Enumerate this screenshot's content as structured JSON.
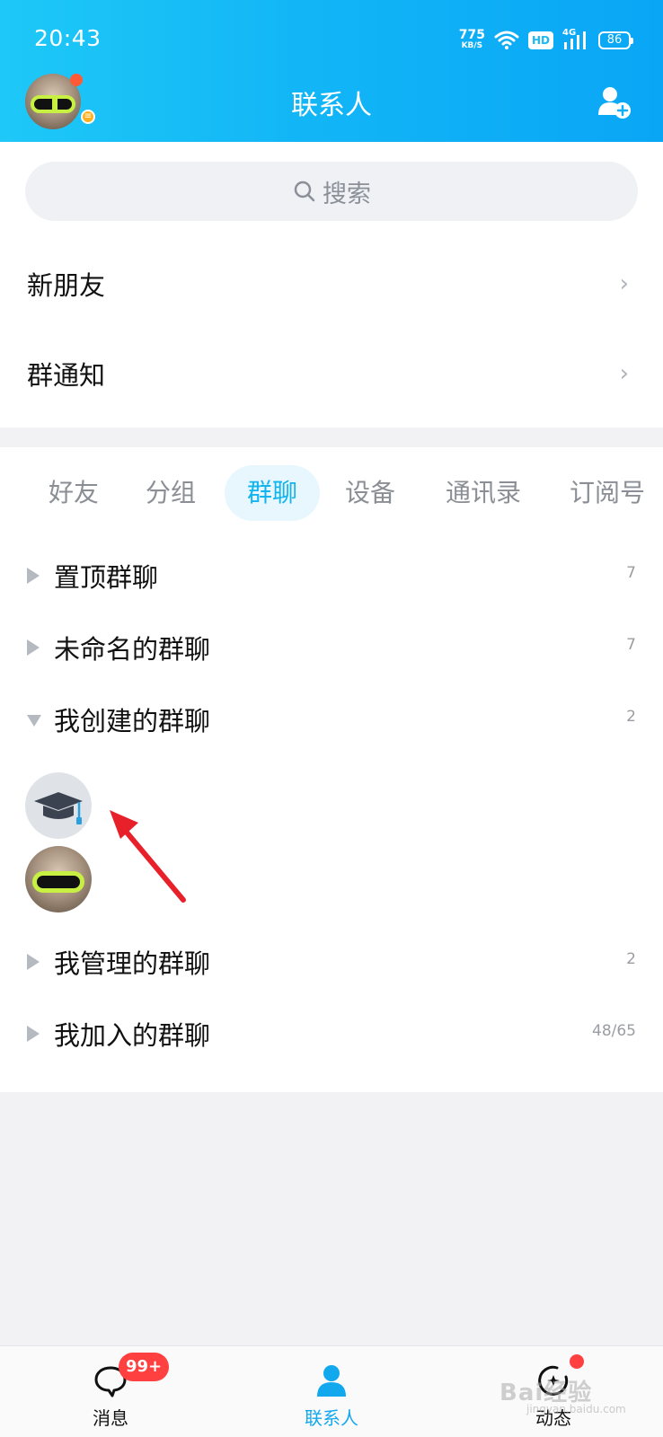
{
  "status_bar": {
    "time": "20:43",
    "net_speed_value": "775",
    "net_speed_unit": "KB/S",
    "hd": "HD",
    "network": "4G",
    "battery": "86"
  },
  "header": {
    "title": "联系人",
    "avatar_status_icon": "menu-icon"
  },
  "search": {
    "placeholder": "搜索"
  },
  "entries": [
    {
      "label": "新朋友"
    },
    {
      "label": "群通知"
    }
  ],
  "tabs": [
    {
      "label": "好友",
      "active": false
    },
    {
      "label": "分组",
      "active": false
    },
    {
      "label": "群聊",
      "active": true
    },
    {
      "label": "设备",
      "active": false
    },
    {
      "label": "通讯录",
      "active": false
    },
    {
      "label": "订阅号",
      "active": false
    }
  ],
  "groups": [
    {
      "name": "置顶群聊",
      "count": "7",
      "expanded": false
    },
    {
      "name": "未命名的群聊",
      "count": "7",
      "expanded": false
    },
    {
      "name": "我创建的群聊",
      "count": "2",
      "expanded": true
    },
    {
      "name": "我管理的群聊",
      "count": "2",
      "expanded": false
    },
    {
      "name": "我加入的群聊",
      "count": "48/65",
      "expanded": false
    }
  ],
  "created_groups": [
    {
      "avatar_icon": "graduation-cap-icon"
    },
    {
      "avatar_icon": "dog-goggles-photo"
    }
  ],
  "bottom_nav": {
    "messages_label": "消息",
    "messages_badge": "99+",
    "contacts_label": "联系人",
    "feed_label": "动态"
  },
  "watermark": {
    "text": "Bai经验",
    "sub": "jingyan.baidu.com"
  },
  "colors": {
    "accent": "#12b4ee",
    "header_start": "#1ec8f7",
    "header_end": "#0aa6f6",
    "badge": "#ff4040",
    "annotation_arrow": "#e8202a"
  }
}
